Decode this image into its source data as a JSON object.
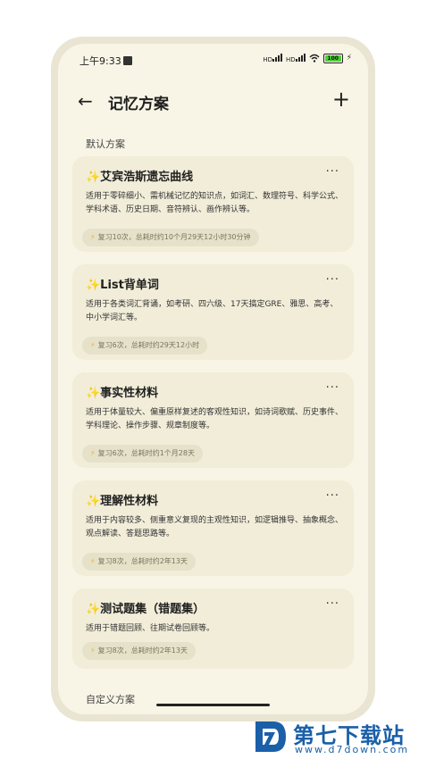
{
  "status": {
    "time": "上午9:33",
    "net1": "HD",
    "net2": "HD",
    "battery": "100"
  },
  "header": {
    "title": "记忆方案"
  },
  "sections": {
    "default": "默认方案",
    "custom": "自定义方案"
  },
  "plans": [
    {
      "title": "✨艾宾浩斯遗忘曲线",
      "desc": "适用于零碎细小、需机械记忆的知识点，如词汇、数理符号、科学公式、学科术语、历史日期、音符辨认、画作辨认等。",
      "stats": "复习10次，总耗时约10个月29天12小时30分钟"
    },
    {
      "title": "✨List背单词",
      "desc": "适用于各类词汇背诵，如考研、四六级、17天搞定GRE、雅思、高考、中小学词汇等。",
      "stats": "复习6次，总耗时约29天12小时"
    },
    {
      "title": "✨事实性材料",
      "desc": "适用于体量较大、偏重原样复述的客观性知识，如诗词歌赋、历史事件、学科理论、操作步骤、规章制度等。",
      "stats": "复习6次，总耗时约1个月28天"
    },
    {
      "title": "✨理解性材料",
      "desc": "适用于内容较多、侧重意义复现的主观性知识，如逻辑推导、抽象概念、观点解读、答题思路等。",
      "stats": "复习8次，总耗时约2年13天"
    },
    {
      "title": "✨测试题集（错题集）",
      "desc": "适用于错题回顾、往期试卷回顾等。",
      "stats": "复习8次，总耗时约2年13天"
    }
  ],
  "watermark": {
    "name": "第七下载站",
    "url": "www.d7down.com"
  },
  "colors": {
    "background": "#f8f5e6",
    "card": "#f1edd9",
    "chip": "#e6e1c9",
    "accent": "#e8b23a",
    "brand": "#1a5fa8"
  }
}
